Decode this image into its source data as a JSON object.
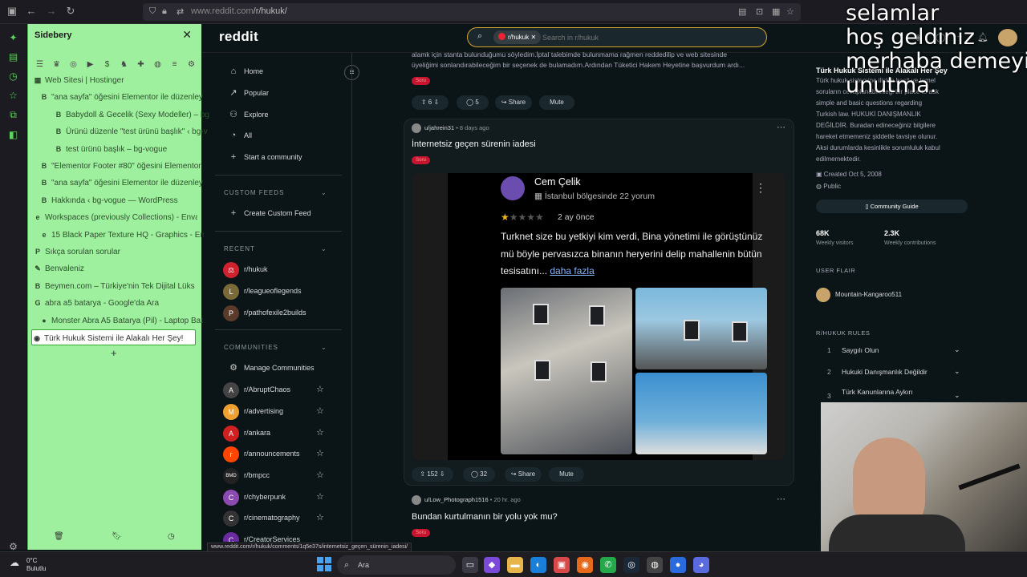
{
  "browser": {
    "url_host": "www.reddit.com",
    "url_path": "/r/hukuk/"
  },
  "sidebery": {
    "title": "Sidebery",
    "tabs": [
      {
        "label": "Web Sitesi | Hostinger",
        "fav": "▦"
      },
      {
        "label": "\"ana sayfa\" öğesini Elementor ile düzenley",
        "fav": "B"
      },
      {
        "label": "Babydoll & Gecelik (Sexy Modeller) – bg",
        "fav": "B"
      },
      {
        "label": "Ürünü düzenle \"test ürünü başlık\" ‹ bg-v",
        "fav": "B"
      },
      {
        "label": "test ürünü başlık – bg-vogue",
        "fav": "B"
      },
      {
        "label": "\"Elementor Footer #80\" öğesini Elementor",
        "fav": "B"
      },
      {
        "label": "\"ana sayfa\" öğesini Elementor ile düzenley",
        "fav": "B"
      },
      {
        "label": "Hakkında ‹ bg-vogue — WordPress",
        "fav": "B"
      },
      {
        "label": "Workspaces (previously Collections) - Envat",
        "fav": "e"
      },
      {
        "label": "15 Black Paper Texture HQ - Graphics - Env",
        "fav": "e"
      },
      {
        "label": "Sıkça sorulan sorular",
        "fav": "P"
      },
      {
        "label": "Benvaleniz",
        "fav": "✎"
      },
      {
        "label": "Beymen.com – Türkiye'nin Tek Dijital Lüks Pl",
        "fav": "B"
      },
      {
        "label": "abra a5 batarya - Google'da Ara",
        "fav": "G"
      },
      {
        "label": "Monster Abra A5 Batarya (Pil) - Laptop Bat",
        "fav": "●"
      },
      {
        "label": "Türk Hukuk Sistemi ile Alakalı Her Şey!",
        "fav": "◉"
      }
    ]
  },
  "reddit": {
    "logo": "reddit",
    "search_chip": "r/hukuk",
    "search_placeholder": "Search in r/hukuk",
    "nav": {
      "home": "Home",
      "popular": "Popular",
      "explore": "Explore",
      "all": "All",
      "start": "Start a community",
      "custom_feeds_head": "CUSTOM FEEDS",
      "create_feed": "Create Custom Feed",
      "recent_head": "RECENT",
      "recent": [
        "r/hukuk",
        "r/leagueoflegends",
        "r/pathofexile2builds"
      ],
      "communities_head": "COMMUNITIES",
      "manage": "Manage Communities",
      "communities": [
        "r/AbruptChaos",
        "r/advertising",
        "r/ankara",
        "r/announcements",
        "r/bmpcc",
        "r/chyberpunk",
        "r/cinematography",
        "r/CreatorServices"
      ]
    },
    "post1": {
      "text_line1": "alamk için stanta bulunduğumu söyledim.İptal talebimde bulunmama rağmen reddedilip ve web sitesinde",
      "text_line2": "üyeliğimi sonlandırabileceğim bir seçenek de bulamadım.Ardından Tüketici Hakem Heyetine başvurdum ardı...",
      "flair": "Soru",
      "votes": "6",
      "comments": "5",
      "share": "Share",
      "mute": "Mute"
    },
    "post2": {
      "user": "u/jahrein31",
      "age": "• 8 days ago",
      "title": "İnternetsiz geçen sürenin iadesi",
      "flair": "Soru",
      "review": {
        "name": "Cem Çelik",
        "location": "İstanbul bölgesinde 22 yorum",
        "stars_filled": "★",
        "stars_empty": "★★★★",
        "age": "2 ay önce",
        "text": "Turknet size bu yetkiyi kim verdi, Bina yönetimi ile görüştünüz mü böyle pervasızca binanın heryerini delip mahallenin bütün tesisatını...",
        "more": "daha fazla"
      },
      "votes": "152",
      "comments": "32",
      "share": "Share",
      "mute": "Mute"
    },
    "post3": {
      "user": "u/Low_Photograph1516",
      "age": "• 20 hr. ago",
      "title": "Bundan kurtulmanın bir yolu yok mu?",
      "flair": "Soru"
    },
    "sidebar": {
      "title": "Türk Hukuk Sistemi ile Alakalı Her Şey",
      "desc": [
        "Türk hukuk sistemine ilişkin basit ve temel",
        "soruların cevaplanabileceği bir place to ask",
        "simple and basic questions regarding",
        "Turkish law. HUKUKİ DANIŞMANLIK",
        "DEĞİLDİR. Buradan edineceğiniz bilgilere",
        "hareket etmemeniz şiddetle tavsiye olunur.",
        "Aksi durumlarda kesinlikle sorumluluk kabul",
        "edilmemektedir."
      ],
      "created": "Created Oct 5, 2008",
      "public": "Public",
      "guide": "Community Guide",
      "visitors_n": "68K",
      "visitors_l": "Weekly visitors",
      "contrib_n": "2.3K",
      "contrib_l": "Weekly contributions",
      "flair_head": "USER FLAIR",
      "flair_user": "Mountain-Kangaroo511",
      "rules_head": "R/HUKUK RULES",
      "rules": [
        {
          "n": "1",
          "t": "Saygılı Olun"
        },
        {
          "n": "2",
          "t": "Hukuki Danışmanlık Değildir"
        },
        {
          "n": "3",
          "t": "Türk Kanunlarına Aykırı"
        }
      ]
    }
  },
  "overlay": {
    "line1": "selamlar",
    "line2": "hoş geldiniz",
    "line3": "merhaba demeyi",
    "line4": "unutma."
  },
  "status_url": "www.reddit.com/r/hukuk/comments/1q5e37s/internetsiz_geçen_sürenin_iadesi/",
  "taskbar": {
    "temp": "0°C",
    "weather": "Bulutlu",
    "search": "Ara"
  },
  "colors": {
    "sidebery_bg": "#9ef09e",
    "reddit_bg": "#0b1416",
    "search_border": "#d6a52a",
    "flair": "#c8152f"
  }
}
